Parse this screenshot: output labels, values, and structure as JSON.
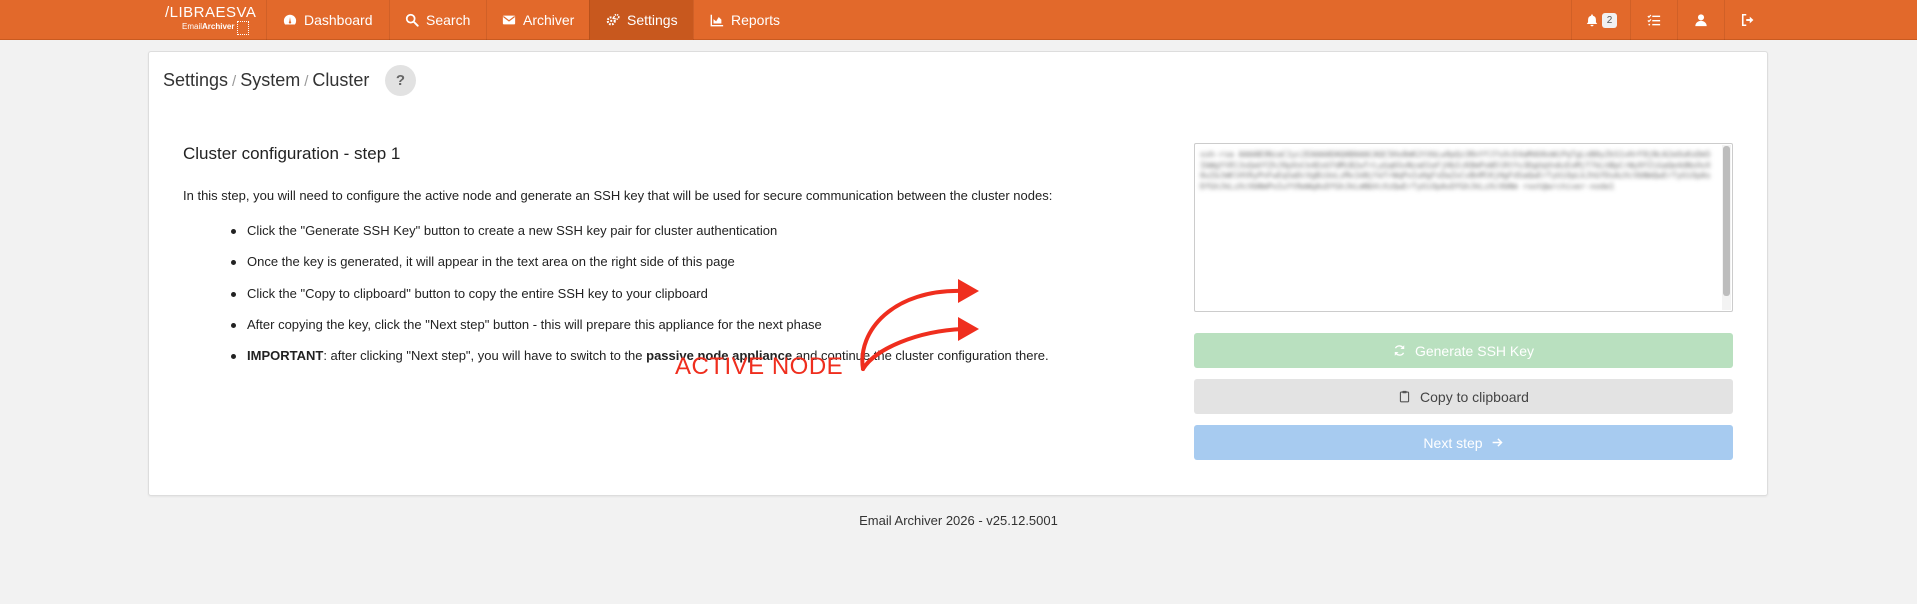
{
  "brand": {
    "logo_text": "/LIBRAESVA",
    "logo_sub_prefix": "Email",
    "logo_sub_bold": "Archiver"
  },
  "nav": {
    "items": [
      {
        "label": "Dashboard",
        "icon": "dashboard-icon"
      },
      {
        "label": "Search",
        "icon": "search-icon"
      },
      {
        "label": "Archiver",
        "icon": "envelope-icon"
      },
      {
        "label": "Settings",
        "icon": "gears-icon",
        "active": true
      },
      {
        "label": "Reports",
        "icon": "chart-icon"
      }
    ],
    "notifications_count": "2",
    "right_icons": [
      "bell-icon",
      "tasks-icon",
      "user-icon",
      "logout-icon"
    ]
  },
  "breadcrumb": {
    "items": [
      "Settings",
      "System",
      "Cluster"
    ],
    "separator": "/",
    "help_label": "?"
  },
  "content": {
    "title": "Cluster configuration - step 1",
    "intro": "In this step, you will need to configure the active node and generate an SSH key that will be used for secure communication between the cluster nodes:",
    "steps": [
      "Click the \"Generate SSH Key\" button to create a new SSH key pair for cluster authentication",
      "Once the key is generated, it will appear in the text area on the right side of this page",
      "Click the \"Copy to clipboard\" button to copy the entire SSH key to your clipboard",
      "After copying the key, click the \"Next step\" button - this will prepare this appliance for the next phase"
    ],
    "important": {
      "label": "IMPORTANT",
      "text_1": ": after clicking \"Next step\", you will have to switch to the ",
      "bold": "passive node appliance",
      "text_2": " and continue the cluster configuration there."
    }
  },
  "annotation": {
    "label": "ACTIVE NODE",
    "color": "#ef2e1e"
  },
  "ssh_key_area": {
    "content": "ssh-rsa AAAAB3NzaC1yc2EAAAADAQABAAACAQC5Hx8mK2tVbLw9pQz3RnYfJ7sXcE4aMdU6oWiPqTgLnB0yZkS1vHrF8jNcA2eOuKxDm5IbWgYtRl3sQaVfZhJ9pXnCk4EoU7dMiB2wTrLyGq6SvNzaO1eFjHbIcK8mPxW5lRtYs3DgUqVnAzEoMjT7kLhBpCrWy9fZiGaQe4dNsOvX0uIbJmKlHtRyPnFwEqSaDcVgBiUoLzMx1kNjYeTrWqPoIuHgFsDaZxCvBnMlKjHgFdSaQwErTyUiOpLkJhGfDsAzXcVbNmQwErTyUiOpAsDfGhJkLzXcVbNmPoIuYtReWqAsDfGhJkLmNbVcXzQwErTyUiOpAsDfGhJkLzXcVbNm root@archiver-node1"
  },
  "buttons": {
    "generate": "Generate SSH Key",
    "copy": "Copy to clipboard",
    "next": "Next step"
  },
  "footer": {
    "text": "Email Archiver 2026 - v25.12.5001"
  },
  "colors": {
    "brand": "#e2692b",
    "nav_active": "#c8581e",
    "generate_button": "#b9e0bf",
    "copy_button": "#e3e3e3",
    "next_button": "#a7cbf0"
  }
}
